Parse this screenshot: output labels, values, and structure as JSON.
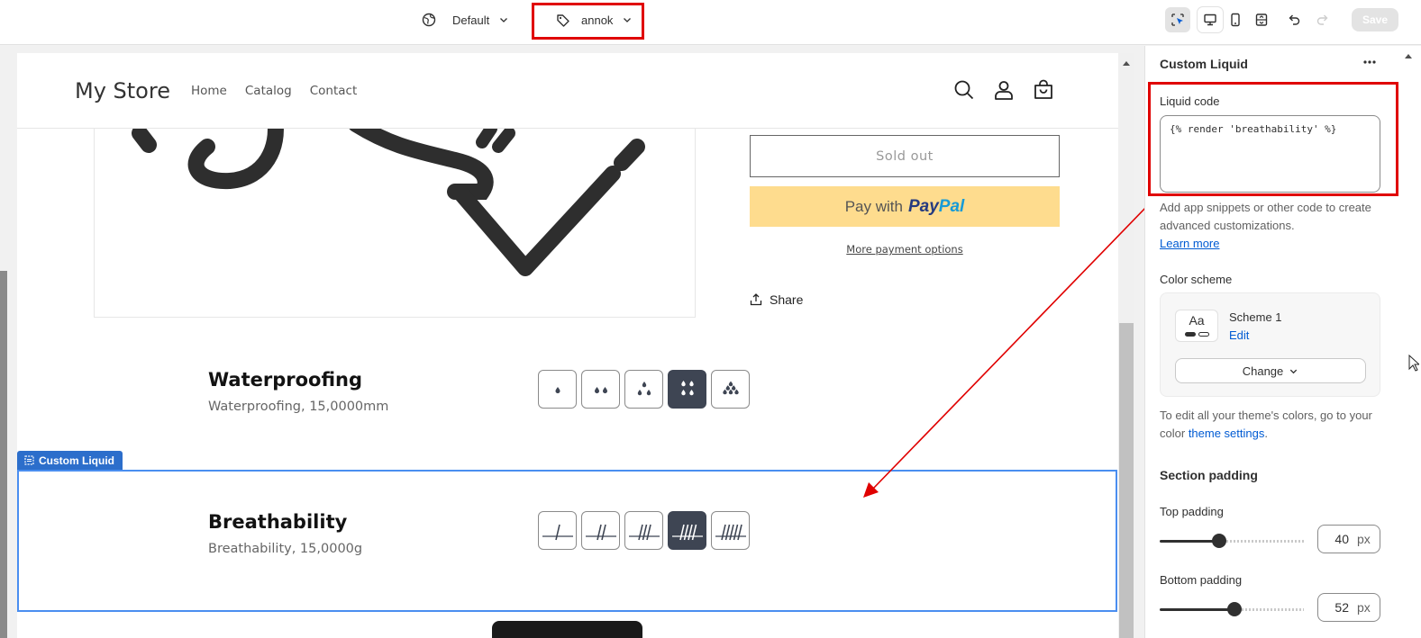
{
  "topbar": {
    "theme_label": "Default",
    "template_label": "annok",
    "save_label": "Save"
  },
  "store": {
    "logo": "My Store",
    "nav": [
      "Home",
      "Catalog",
      "Contact"
    ]
  },
  "product": {
    "sold_out": "Sold out",
    "paypal_prefix": "Pay with",
    "paypal_brand_a": "Pay",
    "paypal_brand_b": "Pal",
    "more_payment": "More payment options",
    "share": "Share"
  },
  "features": [
    {
      "title": "Waterproofing",
      "subtitle": "Waterproofing, 15,0000mm",
      "level": 4,
      "max": 5
    },
    {
      "title": "Breathability",
      "subtitle": "Breathability, 15,0000g",
      "level": 4,
      "max": 5
    }
  ],
  "selected_section_tag": "Custom Liquid",
  "panel": {
    "title": "Custom Liquid",
    "liquid_label": "Liquid code",
    "liquid_value": "{% render 'breathability' %}",
    "help_text": "Add app snippets or other code to create advanced customizations.",
    "learn_more": "Learn more",
    "color_scheme_label": "Color scheme",
    "scheme_swatch": "Aa",
    "scheme_name": "Scheme 1",
    "scheme_edit": "Edit",
    "change_label": "Change",
    "colors_note_prefix": "To edit all your theme's colors, go to your color",
    "colors_note_link": "theme settings",
    "colors_note_suffix": ".",
    "section_padding": "Section padding",
    "top_padding_label": "Top padding",
    "top_padding_value": "40",
    "top_padding_unit": "px",
    "top_padding_fraction": 0.4,
    "bottom_padding_label": "Bottom padding",
    "bottom_padding_value": "52",
    "bottom_padding_unit": "px",
    "bottom_padding_fraction": 0.52
  }
}
